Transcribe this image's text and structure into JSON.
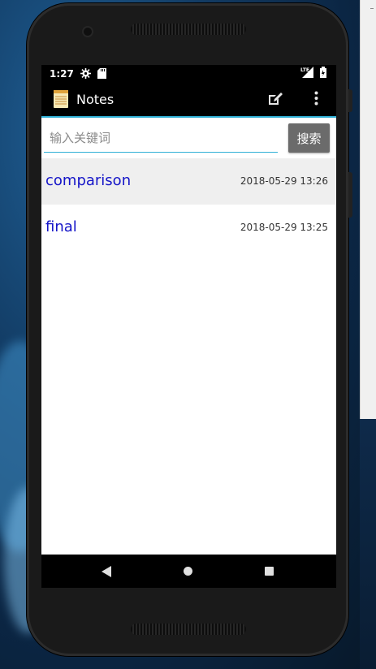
{
  "status_bar": {
    "time": "1:27",
    "icons": [
      "gear-icon",
      "sd-card-icon"
    ],
    "right_icons": [
      "lte-signal-icon",
      "battery-icon"
    ]
  },
  "action_bar": {
    "title": "Notes",
    "app_icon": "notepad-icon",
    "actions": [
      "compose-icon",
      "overflow-menu-icon"
    ]
  },
  "search": {
    "placeholder": "输入关键词",
    "value": "",
    "button_label": "搜索"
  },
  "notes": [
    {
      "title": "comparison",
      "date": "2018-05-29  13:26",
      "selected": true
    },
    {
      "title": "final",
      "date": "2018-05-29  13:25",
      "selected": false
    }
  ],
  "nav_bar": {
    "buttons": [
      "back-icon",
      "home-icon",
      "recents-icon"
    ]
  },
  "colors": {
    "accent": "#2fb0d6",
    "note_title": "#1515c8",
    "search_button": "#6b6b6b",
    "selected_row": "#efefef"
  }
}
